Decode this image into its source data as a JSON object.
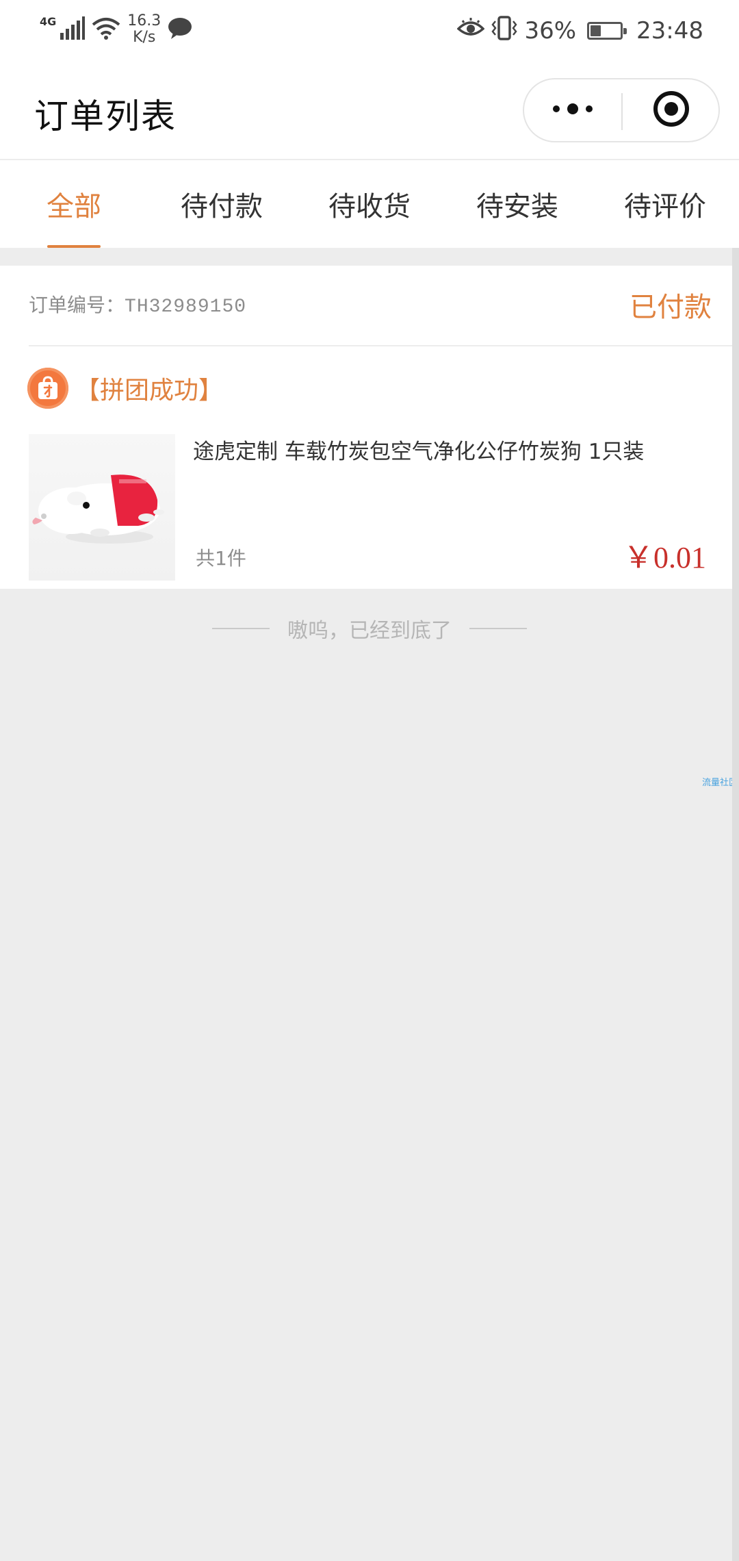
{
  "status_bar": {
    "network": "4G",
    "speed_value": "16.3",
    "speed_unit": "K/s",
    "battery": "36%",
    "battery_level": 0.36,
    "time": "23:48"
  },
  "header": {
    "title": "订单列表"
  },
  "tabs": [
    {
      "label": "全部",
      "active": true
    },
    {
      "label": "待付款",
      "active": false
    },
    {
      "label": "待收货",
      "active": false
    },
    {
      "label": "待安装",
      "active": false
    },
    {
      "label": "待评价",
      "active": false
    }
  ],
  "order": {
    "number_label": "订单编号：",
    "number": "TH32989150",
    "status": "已付款",
    "group_status": "【拼团成功】",
    "product_name": "途虎定制 车载竹炭包空气净化公仔竹炭狗 1只装",
    "quantity": "共1件",
    "price": "￥0.01"
  },
  "footer": {
    "end_text": "嗷呜，已经到底了"
  },
  "watermark": "流量社区",
  "colors": {
    "accent": "#e0823f",
    "price": "#c8302b",
    "page_bg": "#ededed"
  }
}
